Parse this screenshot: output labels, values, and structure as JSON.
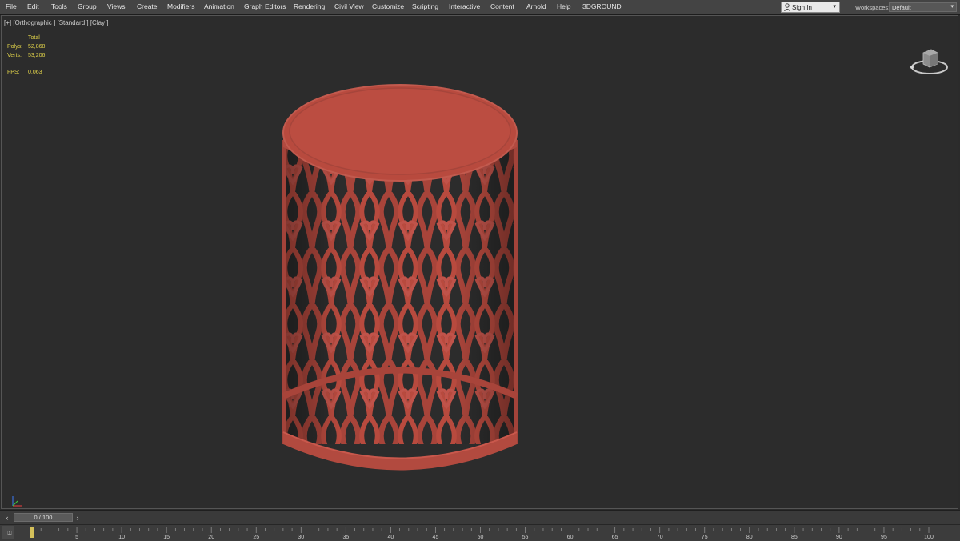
{
  "menubar": {
    "items": [
      "File",
      "Edit",
      "Tools",
      "Group",
      "Views",
      "Create",
      "Modifiers",
      "Animation",
      "Graph Editors",
      "Rendering",
      "Civil View",
      "Customize",
      "Scripting",
      "Interactive",
      "Content",
      "Arnold",
      "Help",
      "3DGROUND"
    ],
    "sign_in": "Sign In",
    "workspaces_label": "Workspaces:",
    "workspace_value": "Default"
  },
  "viewport": {
    "label": "[+] [Orthographic ] [Standard ] [Clay ]",
    "stats": {
      "total_label": "Total",
      "polys_label": "Polys:",
      "polys_value": "52,868",
      "verts_label": "Verts:",
      "verts_value": "53,206",
      "fps_label": "FPS:",
      "fps_value": "0.063"
    },
    "model_color": "#b84a3e"
  },
  "timeline": {
    "frame_display": "0 / 100",
    "prev_icon": "chevron-left-icon",
    "next_icon": "chevron-right-icon",
    "ticks": [
      "0",
      "5",
      "10",
      "15",
      "20",
      "25",
      "30",
      "35",
      "40",
      "45",
      "50",
      "55",
      "60",
      "65",
      "70",
      "75",
      "80",
      "85",
      "90",
      "95",
      "100"
    ],
    "current_frame": 0
  }
}
